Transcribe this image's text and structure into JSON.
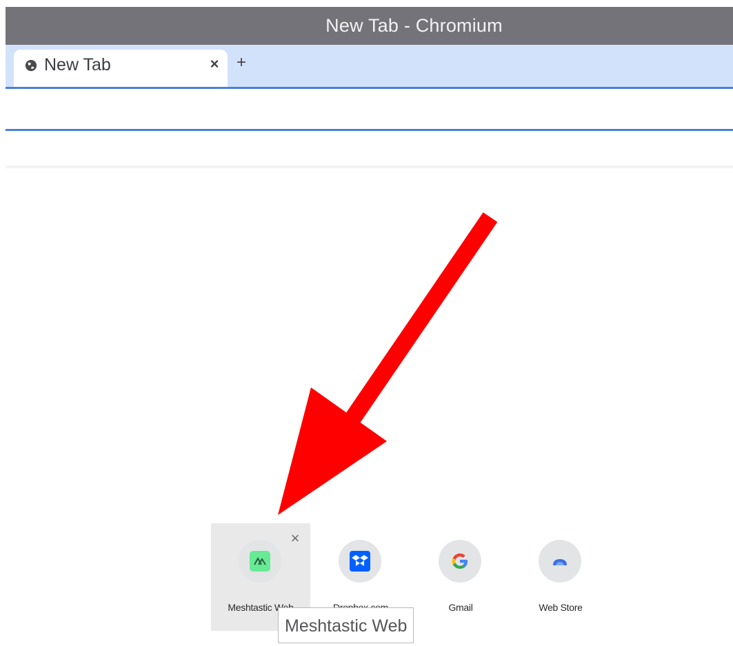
{
  "window": {
    "title": "New Tab - Chromium"
  },
  "tabs": [
    {
      "label": "New Tab",
      "close_glyph": "×",
      "icon": "globe-icon"
    }
  ],
  "new_tab_glyph": "+",
  "shortcuts": [
    {
      "label": "Meshtastic Web",
      "icon": "meshtastic-icon",
      "hovered": true
    },
    {
      "label": "Dropbox.com",
      "icon": "dropbox-icon",
      "hovered": false
    },
    {
      "label": "Gmail",
      "icon": "google-icon",
      "hovered": false
    },
    {
      "label": "Web Store",
      "icon": "web-store-icon",
      "hovered": false
    }
  ],
  "shortcut_remove_glyph": "×",
  "tooltip": {
    "text": "Meshtastic Web"
  },
  "annotation": {
    "type": "arrow",
    "color": "#ff0000",
    "points_to": "Meshtastic Web"
  },
  "colors": {
    "titlebar": "#75737a",
    "tabstrip": "#d3e2fb",
    "accent": "#4b7fd6",
    "meshtastic_green": "#67ea94",
    "dropbox_blue": "#0061fe"
  }
}
